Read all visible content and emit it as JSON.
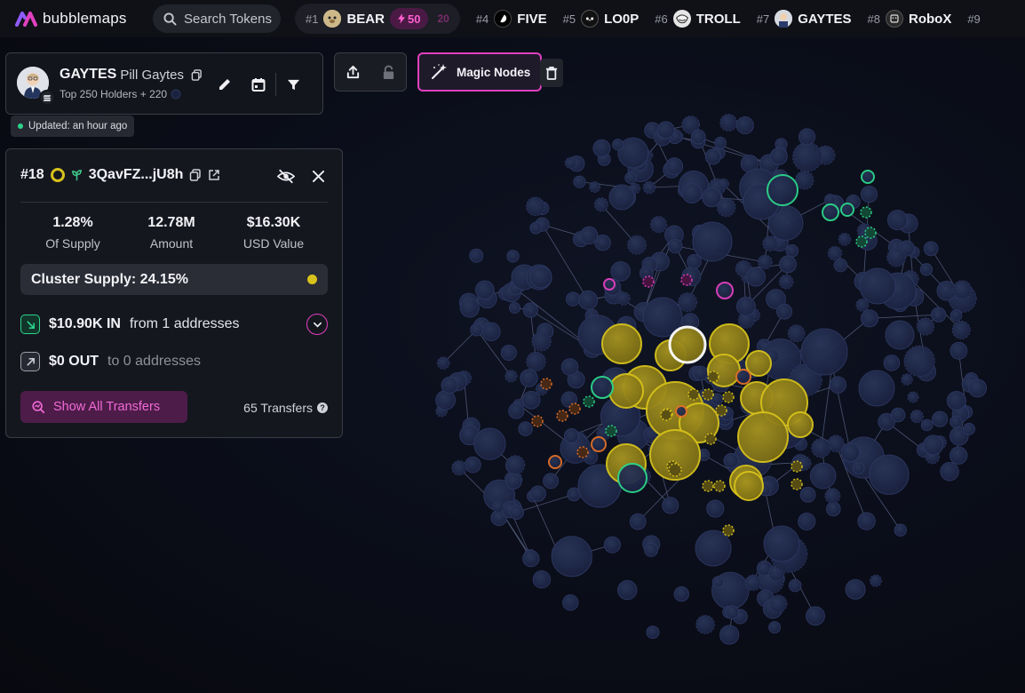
{
  "app": {
    "name": "bubblemaps"
  },
  "search": {
    "placeholder": "Search Tokens"
  },
  "colors": {
    "accent": "#e040c0",
    "cluster_yellow": "#d7c21b",
    "green": "#2cd48a",
    "orange": "#e0702a",
    "magenta": "#e040c0",
    "node": "#1f2a48"
  },
  "ticker": {
    "items": [
      {
        "rank": "#1",
        "name": "BEAR",
        "avatar_color": "#d8c7a0",
        "boost": "50",
        "boost_next": "20"
      },
      {
        "rank": "#4",
        "name": "FIVE",
        "avatar_color": "#000000"
      },
      {
        "rank": "#5",
        "name": "LO0P",
        "avatar_color": "#111111"
      },
      {
        "rank": "#6",
        "name": "TROLL",
        "avatar_color": "#e6e6e6"
      },
      {
        "rank": "#7",
        "name": "GAYTES",
        "avatar_color": "#cfd3dc"
      },
      {
        "rank": "#8",
        "name": "RoboX",
        "avatar_color": "#2a2a2a"
      },
      {
        "rank": "#9",
        "name": ""
      }
    ]
  },
  "token": {
    "symbol": "GAYTES",
    "name": "Pill Gaytes",
    "subtitle": "Top 250 Holders + 220",
    "updated": "Updated: an hour ago"
  },
  "toolbar": {
    "magic_nodes_label": "Magic Nodes"
  },
  "holder": {
    "rank": "#18",
    "address": "3QavFZ...jU8h",
    "stats": [
      {
        "value": "1.28%",
        "label": "Of Supply"
      },
      {
        "value": "12.78M",
        "label": "Amount"
      },
      {
        "value": "$16.30K",
        "label": "USD Value"
      }
    ],
    "cluster_supply": "Cluster Supply: 24.15%",
    "in": {
      "amount": "$10.90K IN",
      "detail": "from 1 addresses"
    },
    "out": {
      "amount": "$0 OUT",
      "detail": "to 0 addresses"
    },
    "show_all_label": "Show All Transfers",
    "transfers_count": "65 Transfers"
  }
}
